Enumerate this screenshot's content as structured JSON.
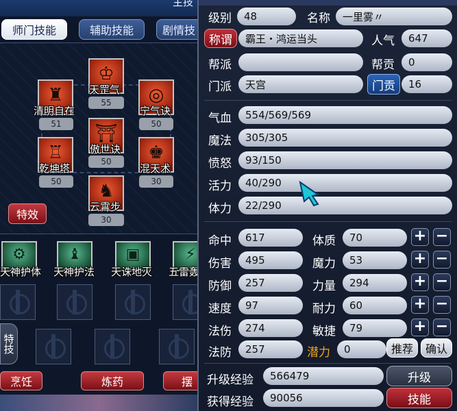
{
  "window_title": "主技",
  "tabs": [
    {
      "label": "师门技能",
      "active": true
    },
    {
      "label": "辅助技能",
      "active": false
    },
    {
      "label": "剧情技",
      "active": false
    }
  ],
  "skills": [
    {
      "name": "天罡气",
      "level": "55",
      "icon": "qi-icon"
    },
    {
      "name": "清明自在",
      "level": "51",
      "icon": "drum-icon"
    },
    {
      "name": "宁气诀",
      "level": "50",
      "icon": "orb-icon"
    },
    {
      "name": "傲世诀",
      "level": "50",
      "icon": "gate-icon"
    },
    {
      "name": "乾坤塔",
      "level": "50",
      "icon": "pagoda-icon"
    },
    {
      "name": "混天术",
      "level": "30",
      "icon": "warrior-icon"
    },
    {
      "name": "云霄步",
      "level": "30",
      "icon": "boot-icon"
    }
  ],
  "effects_button": "特效",
  "aux_skills": [
    "天神护体",
    "天神护法",
    "天诛地灭",
    "五雷轰"
  ],
  "special_label": "特技",
  "bottom_buttons": [
    "烹饪",
    "炼药",
    "摆"
  ],
  "character": {
    "level_label": "级别",
    "level": "48",
    "name_label": "名称",
    "name": "一里雾〃",
    "title_label": "称谓",
    "title": "霸王・鸿运当头",
    "popularity_label": "人气",
    "popularity": "647",
    "guild_label": "帮派",
    "guild": "",
    "guild_contrib_label": "帮贡",
    "guild_contrib": "0",
    "sect_label": "门派",
    "sect": "天宫",
    "sect_contrib_label": "门贡",
    "sect_contrib": "16"
  },
  "status": {
    "hp_label": "气血",
    "hp": "554/569/569",
    "mp_label": "魔法",
    "mp": "305/305",
    "rage_label": "愤怒",
    "rage": "93/150",
    "vitality_label": "活力",
    "vitality": "40/290",
    "stamina_label": "体力",
    "stamina": "22/290"
  },
  "attributes": [
    {
      "label": "命中",
      "value": "617",
      "attr": "体质",
      "attr_value": "70"
    },
    {
      "label": "伤害",
      "value": "495",
      "attr": "魔力",
      "attr_value": "53"
    },
    {
      "label": "防御",
      "value": "257",
      "attr": "力量",
      "attr_value": "294"
    },
    {
      "label": "速度",
      "value": "97",
      "attr": "耐力",
      "attr_value": "60"
    },
    {
      "label": "法伤",
      "value": "274",
      "attr": "敏捷",
      "attr_value": "79"
    }
  ],
  "plus": "+",
  "minus": "−",
  "mdef_label": "法防",
  "mdef": "257",
  "potential_label": "潜力",
  "potential": "0",
  "recommend_button": "推荐",
  "confirm_button": "确认",
  "exp": {
    "upgrade_label": "升级经验",
    "upgrade": "566479",
    "gained_label": "获得经验",
    "gained": "90056",
    "upgrade_button": "升级",
    "skill_button": "技能"
  }
}
